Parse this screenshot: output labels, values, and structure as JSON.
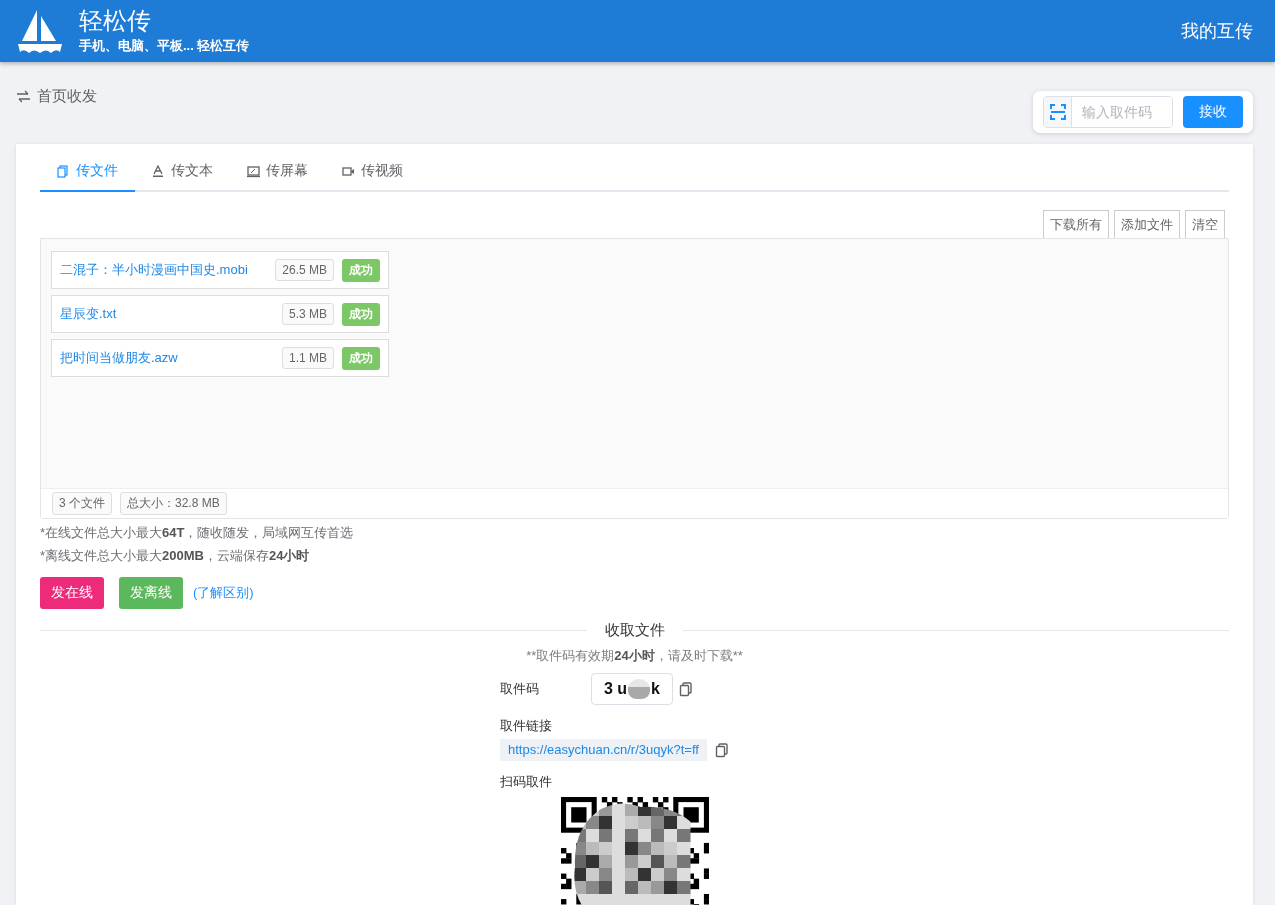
{
  "header": {
    "title": "轻松传",
    "subtitle": "手机、电脑、平板... 轻松互传",
    "nav_link": "我的互传"
  },
  "breadcrumb": {
    "label": "首页收发"
  },
  "receive_bar": {
    "placeholder": "输入取件码",
    "button": "接收"
  },
  "tabs": [
    {
      "label": "传文件",
      "kind": "file",
      "selected": true
    },
    {
      "label": "传文本",
      "kind": "text",
      "selected": false
    },
    {
      "label": "传屏幕",
      "kind": "screen",
      "selected": false
    },
    {
      "label": "传视频",
      "kind": "video",
      "selected": false
    }
  ],
  "file_actions": [
    "下载所有",
    "添加文件",
    "清空"
  ],
  "files": [
    {
      "name": "二混子：半小时漫画中国史.mobi",
      "size": "26.5 MB",
      "status": "成功"
    },
    {
      "name": "星辰变.txt",
      "size": "5.3 MB",
      "status": "成功"
    },
    {
      "name": "把时间当做朋友.azw",
      "size": "1.1 MB",
      "status": "成功"
    }
  ],
  "summary": {
    "count": "3 个文件",
    "total": "总大小：32.8 MB"
  },
  "notes": [
    "*在线文件总大小最大**64T**，随收随发，局域网互传首选",
    "*离线文件总大小最大**200MB**，云端保存**24小时**"
  ],
  "send_buttons": [
    {
      "label": "发在线",
      "color": "#ee2a7b"
    },
    {
      "label": "发离线",
      "color": "#5cb85c"
    }
  ],
  "difference_link": "(了解区别)",
  "pickup": {
    "title": "收取文件",
    "notice": [
      {
        "text": "**取件码有效期",
        "bold": false
      },
      {
        "text": "24小时",
        "bold": true
      },
      {
        "text": "，请及时下载**",
        "bold": false
      }
    ],
    "code_label": "取件码",
    "code_start": "3 u",
    "code_end": "k",
    "link_label": "取件链接",
    "link": "https://easychuan.cn/r/3uqyk?t=ff",
    "qr_label": "扫码取件"
  }
}
